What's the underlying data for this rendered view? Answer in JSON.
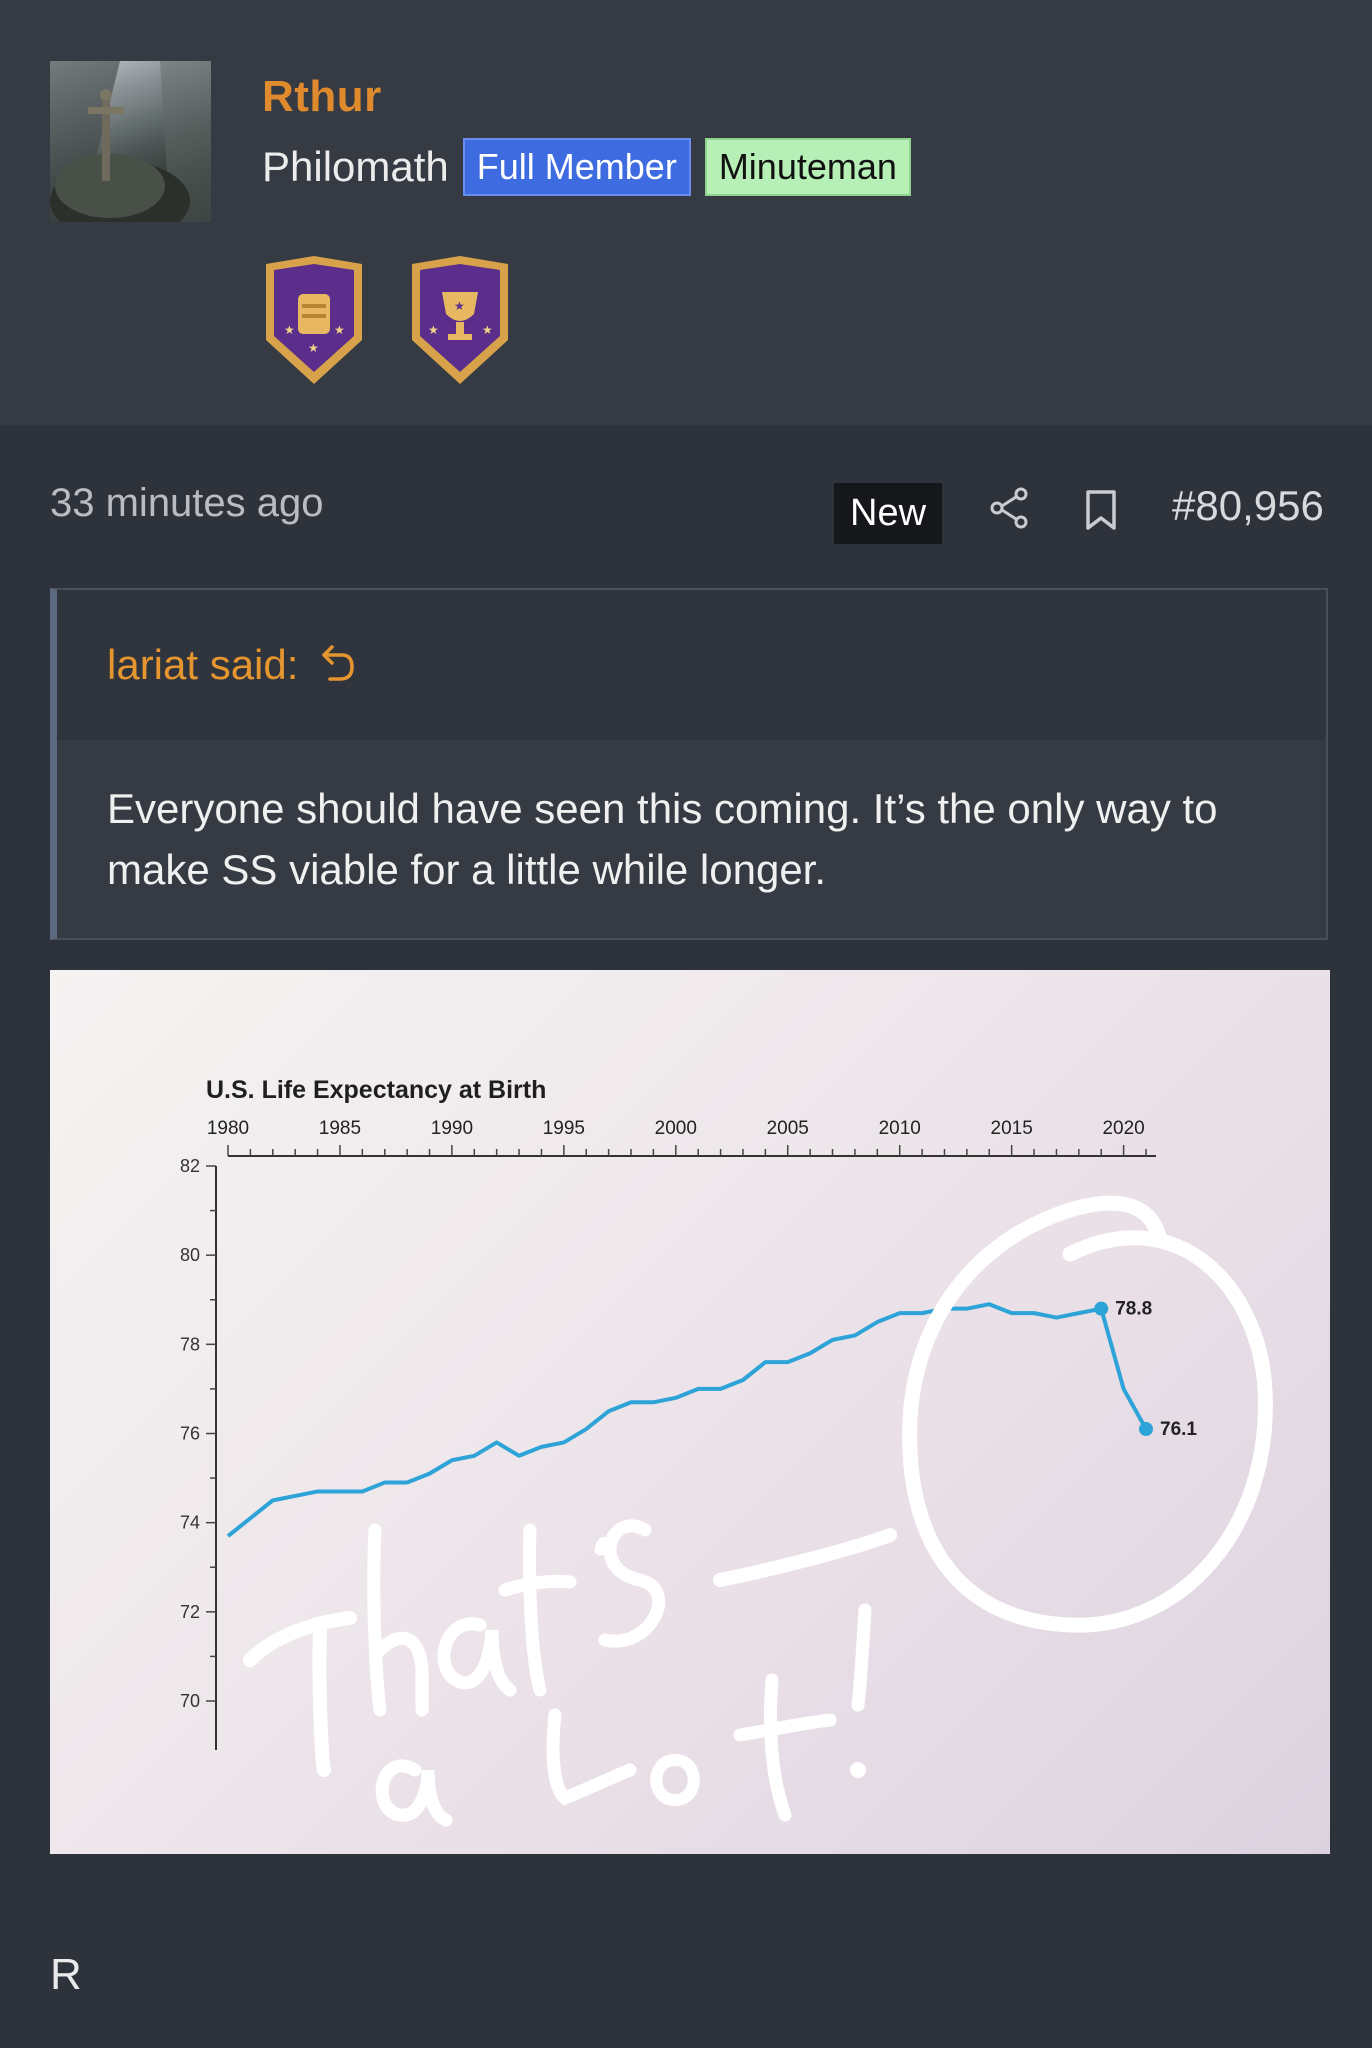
{
  "user": {
    "name": "Rthur",
    "title": "Philomath",
    "badges": [
      "Full Member",
      "Minuteman"
    ]
  },
  "post": {
    "time": "33 minutes ago",
    "new_label": "New",
    "number": "#80,956",
    "quote": {
      "author": "lariat said:",
      "text": "Everyone should have seen this coming. It’s the only way to make SS viable for a little while longer."
    },
    "footer_text": "R"
  },
  "icons": {
    "share": "share-icon",
    "bookmark": "bookmark-icon",
    "reply_arrow": "return-arrow-icon",
    "trophy_1": "armor-trophy-icon",
    "trophy_2": "cup-trophy-icon"
  },
  "colors": {
    "username": "#e08a2e",
    "full_member": "#3e6be0",
    "minuteman": "#b7f0b6",
    "chart_line": "#2ea3d8"
  },
  "chart_data": {
    "type": "line",
    "title": "U.S. Life Expectancy at Birth",
    "x_ticks": [
      "1980",
      "1985",
      "1990",
      "1995",
      "2000",
      "2005",
      "2010",
      "2015",
      "2020"
    ],
    "y_ticks": [
      "82",
      "80",
      "78",
      "76",
      "74",
      "72",
      "70"
    ],
    "ylim": [
      70,
      82
    ],
    "xlim": [
      1980,
      2021
    ],
    "series": [
      {
        "x": [
          1980,
          1981,
          1982,
          1983,
          1984,
          1985,
          1986,
          1987,
          1988,
          1989,
          1990,
          1991,
          1992,
          1993,
          1994,
          1995,
          1996,
          1997,
          1998,
          1999,
          2000,
          2001,
          2002,
          2003,
          2004,
          2005,
          2006,
          2007,
          2008,
          2009,
          2010,
          2011,
          2012,
          2013,
          2014,
          2015,
          2016,
          2017,
          2018,
          2019,
          2020,
          2021
        ],
        "values": [
          73.7,
          74.1,
          74.5,
          74.6,
          74.7,
          74.7,
          74.7,
          74.9,
          74.9,
          75.1,
          75.4,
          75.5,
          75.8,
          75.5,
          75.7,
          75.8,
          76.1,
          76.5,
          76.7,
          76.7,
          76.8,
          77.0,
          77.0,
          77.2,
          77.6,
          77.6,
          77.8,
          78.1,
          78.2,
          78.5,
          78.7,
          78.7,
          78.8,
          78.8,
          78.9,
          78.7,
          78.7,
          78.6,
          78.7,
          78.8,
          77.0,
          76.1
        ]
      }
    ],
    "point_labels": [
      {
        "x": 2019,
        "value": 78.8,
        "label": "78.8"
      },
      {
        "x": 2021,
        "value": 76.1,
        "label": "76.1"
      }
    ],
    "annotation": "That's a Lot!",
    "grid": false
  }
}
